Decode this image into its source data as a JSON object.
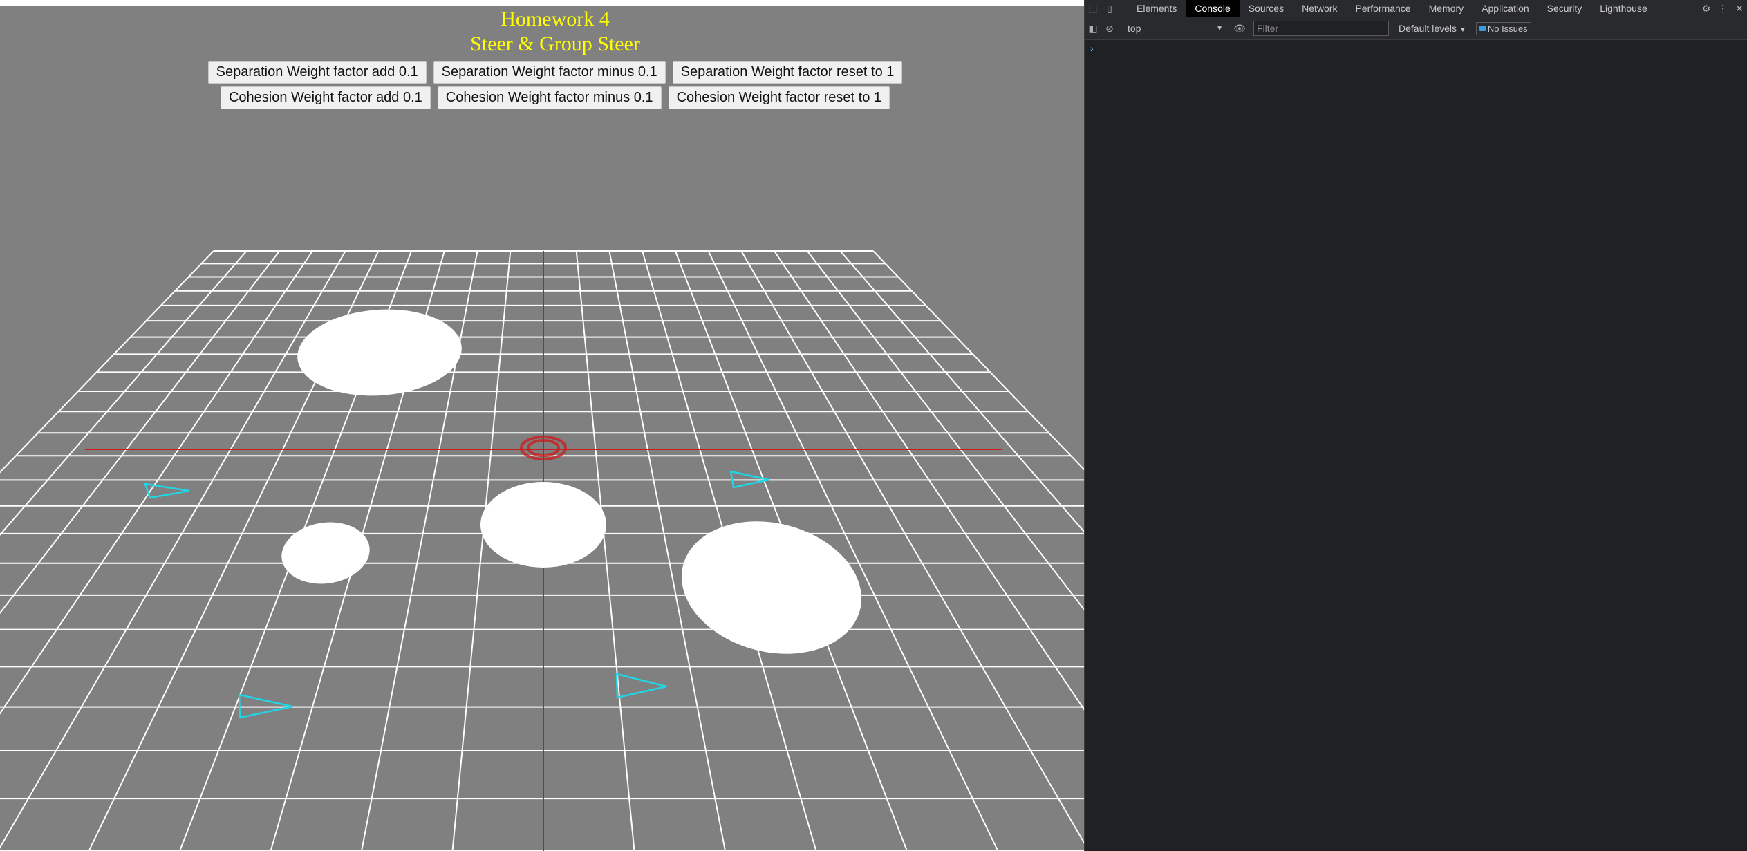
{
  "page": {
    "title_line1": "Homework 4",
    "title_line2": "Steer & Group Steer"
  },
  "controls": {
    "separation": [
      "Separation Weight factor add 0.1",
      "Separation Weight factor minus 0.1",
      "Separation Weight factor reset to 1"
    ],
    "cohesion": [
      "Cohesion Weight factor add 0.1",
      "Cohesion Weight factor minus 0.1",
      "Cohesion Weight factor reset to 1"
    ]
  },
  "devtools": {
    "tabs": [
      "Elements",
      "Console",
      "Sources",
      "Network",
      "Performance",
      "Memory",
      "Application",
      "Security",
      "Lighthouse"
    ],
    "active_tab": "Console",
    "context": "top",
    "filter_placeholder": "Filter",
    "levels": "Default levels",
    "issues": "No Issues",
    "prompt": "›"
  },
  "colors": {
    "background": "#808080",
    "title": "#ffff00",
    "grid": "#ffffff",
    "axis": "#cc1a1a",
    "agent": "#1ed6e6",
    "obstacle": "#ffffff"
  }
}
